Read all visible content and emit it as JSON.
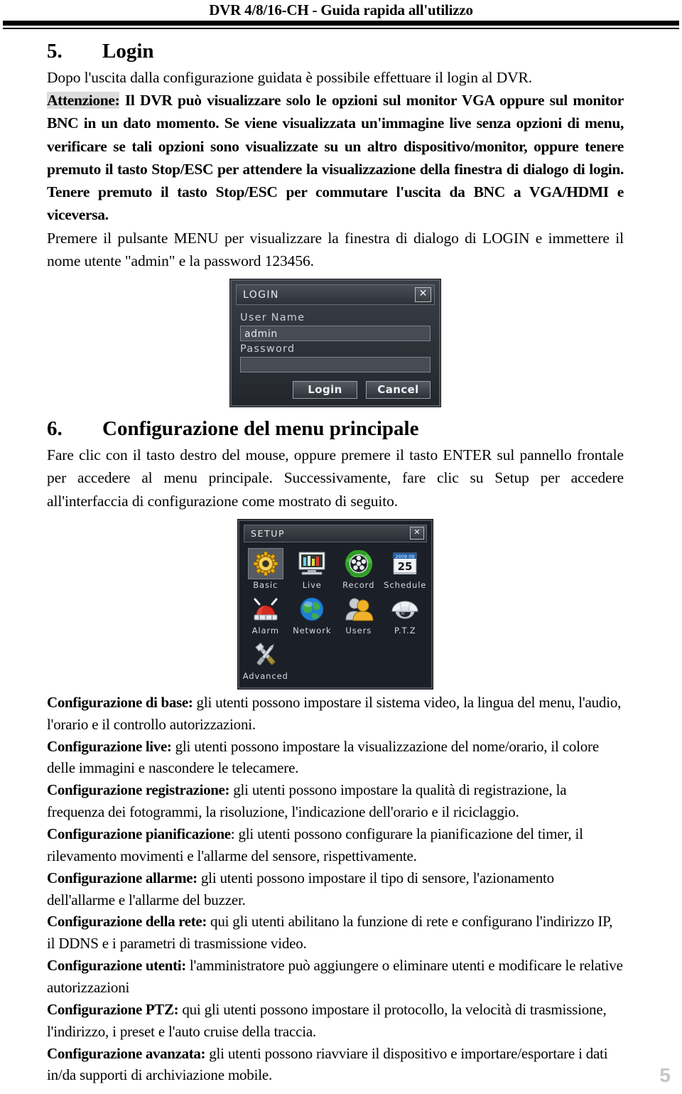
{
  "header": {
    "title": "DVR 4/8/16-CH - Guida rapida all'utilizzo"
  },
  "section5": {
    "number": "5.",
    "title": "Login",
    "intro": "Dopo l'uscita dalla configurazione guidata è possibile effettuare il login al DVR.",
    "warning_label": "Attenzione:",
    "warning_bold": " Il DVR può visualizzare solo le opzioni sul monitor VGA oppure sul monitor BNC in un dato momento. Se viene visualizzata un'immagine live senza opzioni di menu, verificare se tali opzioni sono visualizzate su un altro dispositivo/monitor, oppure tenere premuto il tasto Stop/ESC per attendere la visualizzazione della finestra di dialogo di login. Tenere premuto il tasto Stop/ESC per commutare l'uscita da BNC a VGA/HDMI e viceversa.",
    "instruction": "Premere il pulsante MENU per visualizzare la finestra di dialogo di LOGIN e immettere il nome utente \"admin\" e la password 123456."
  },
  "login_dialog": {
    "title": "LOGIN",
    "close_label": "✕",
    "user_name_label": "User Name",
    "user_name_value": "admin",
    "password_label": "Password",
    "password_value": "",
    "login_button": "Login",
    "cancel_button": "Cancel"
  },
  "section6": {
    "number": "6.",
    "title": "Configurazione del menu principale",
    "paragraph": "Fare clic con il tasto destro del mouse, oppure premere il tasto ENTER sul pannello frontale per accedere al menu principale. Successivamente, fare clic su Setup per accedere all'interfaccia di configurazione come mostrato di seguito."
  },
  "setup_dialog": {
    "title": "SETUP",
    "close_label": "✕",
    "items": [
      {
        "label": "Basic",
        "icon": "gear-icon",
        "selected": true
      },
      {
        "label": "Live",
        "icon": "monitor-icon",
        "selected": false
      },
      {
        "label": "Record",
        "icon": "film-reel-icon",
        "selected": false
      },
      {
        "label": "Schedule",
        "icon": "calendar-icon",
        "selected": false
      },
      {
        "label": "Alarm",
        "icon": "siren-icon",
        "selected": false
      },
      {
        "label": "Network",
        "icon": "globe-icon",
        "selected": false
      },
      {
        "label": "Users",
        "icon": "users-icon",
        "selected": false
      },
      {
        "label": "P.T.Z",
        "icon": "dome-camera-icon",
        "selected": false
      },
      {
        "label": "Advanced",
        "icon": "tools-icon",
        "selected": false
      }
    ],
    "calendar": {
      "year_month": "2009  09",
      "day": "25"
    }
  },
  "descriptions": [
    {
      "term": "Configurazione di base:",
      "text": " gli utenti possono impostare il sistema video, la lingua del menu, l'audio, l'orario e il controllo autorizzazioni."
    },
    {
      "term": "Configurazione live:",
      "text": " gli utenti possono impostare la visualizzazione del nome/orario, il colore delle immagini e nascondere le telecamere."
    },
    {
      "term": "Configurazione registrazione:",
      "text": " gli utenti possono impostare la qualità di registrazione, la frequenza dei fotogrammi, la risoluzione, l'indicazione dell'orario e il riciclaggio."
    },
    {
      "term": "Configurazione pianificazione",
      "text": ": gli utenti possono configurare la pianificazione del timer, il rilevamento movimenti e l'allarme del sensore, rispettivamente."
    },
    {
      "term": "Configurazione allarme:",
      "text": " gli utenti possono impostare il tipo di sensore, l'azionamento dell'allarme e l'allarme del buzzer."
    },
    {
      "term": "Configurazione della rete:",
      "text": " qui gli utenti abilitano la funzione di rete e configurano l'indirizzo IP, il DDNS e i parametri di trasmissione video."
    },
    {
      "term": "Configurazione utenti:",
      "text": " l'amministratore può aggiungere o eliminare utenti e modificare le relative autorizzazioni"
    },
    {
      "term": "Configurazione PTZ:",
      "text": " qui gli utenti possono impostare il protocollo, la velocità di trasmissione, l'indirizzo, i preset e l'auto cruise della traccia."
    },
    {
      "term": "Configurazione avanzata:",
      "text": " gli utenti possono riavviare il dispositivo e importare/esportare i dati in/da supporti di archiviazione mobile."
    }
  ],
  "footer": {
    "page_number": "5"
  }
}
